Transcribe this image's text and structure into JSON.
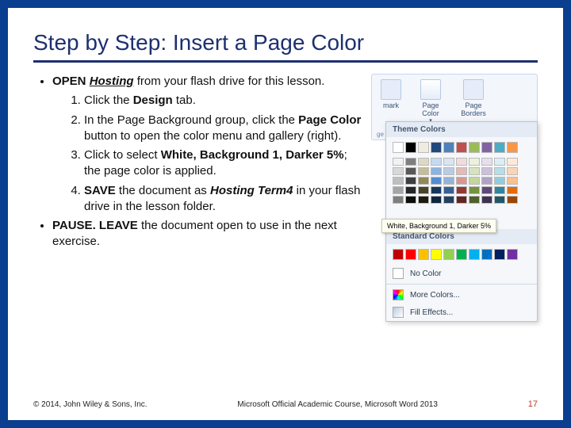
{
  "title": "Step by Step: Insert a Page Color",
  "bullets": {
    "intro_open": "OPEN",
    "intro_file": "Hosting",
    "intro_rest": " from your flash drive for this lesson.",
    "steps": [
      {
        "num": "1.",
        "pre": "Click the ",
        "bold": "Design",
        "post": " tab."
      },
      {
        "num": "2.",
        "pre": "In the Page Background group, click the ",
        "bold": "Page Color",
        "post": " button to open the color menu and gallery (right)."
      },
      {
        "num": "3.",
        "pre": "Click to select ",
        "bold": "White, Background 1, Darker 5%",
        "post": "; the page color is applied."
      },
      {
        "num": "4.",
        "pre": " ",
        "bold": "SAVE",
        "post_pre": " the document as ",
        "file": "Hosting Term4",
        "post": " in your flash drive in the lesson folder."
      }
    ],
    "pause": "PAUSE. LEAVE",
    "pause_rest": " the document open to use in the next exercise."
  },
  "ribbon": {
    "btn1": "mark",
    "btn2": "Page Color",
    "btn3": "Page Borders",
    "group": "ge B"
  },
  "popup": {
    "header": "Theme Colors",
    "tooltip": "White, Background 1, Darker 5%",
    "standard": "Standard Colors",
    "no_color": "No Color",
    "more": "More Colors...",
    "fill": "Fill Effects..."
  },
  "theme_row1": [
    "#ffffff",
    "#000000",
    "#eeece1",
    "#1f497d",
    "#4f81bd",
    "#c0504d",
    "#9bbb59",
    "#8064a2",
    "#4bacc6",
    "#f79646"
  ],
  "theme_shades": [
    [
      "#f2f2f2",
      "#7f7f7f",
      "#ddd9c3",
      "#c6d9f0",
      "#dbe5f1",
      "#f2dcdb",
      "#ebf1dd",
      "#e5e0ec",
      "#dbeef3",
      "#fdeada"
    ],
    [
      "#d8d8d8",
      "#595959",
      "#c4bd97",
      "#8db3e2",
      "#b8cce4",
      "#e5b9b7",
      "#d7e3bc",
      "#ccc1d9",
      "#b7dde8",
      "#fbd5b5"
    ],
    [
      "#bfbfbf",
      "#3f3f3f",
      "#938953",
      "#548dd4",
      "#95b3d7",
      "#d99694",
      "#c3d69b",
      "#b2a2c7",
      "#92cddc",
      "#fac08f"
    ],
    [
      "#a5a5a5",
      "#262626",
      "#494429",
      "#17365d",
      "#366092",
      "#953734",
      "#76923c",
      "#5f497a",
      "#31859b",
      "#e36c09"
    ],
    [
      "#7f7f7f",
      "#0c0c0c",
      "#1d1b10",
      "#0f243e",
      "#244061",
      "#632423",
      "#4f6128",
      "#3f3151",
      "#205867",
      "#974806"
    ]
  ],
  "standard_colors": [
    "#c00000",
    "#ff0000",
    "#ffc000",
    "#ffff00",
    "#92d050",
    "#00b050",
    "#00b0f0",
    "#0070c0",
    "#002060",
    "#7030a0"
  ],
  "footer": {
    "copyright": "© 2014, John Wiley & Sons, Inc.",
    "course": "Microsoft Official Academic Course, Microsoft Word 2013",
    "page": "17"
  }
}
